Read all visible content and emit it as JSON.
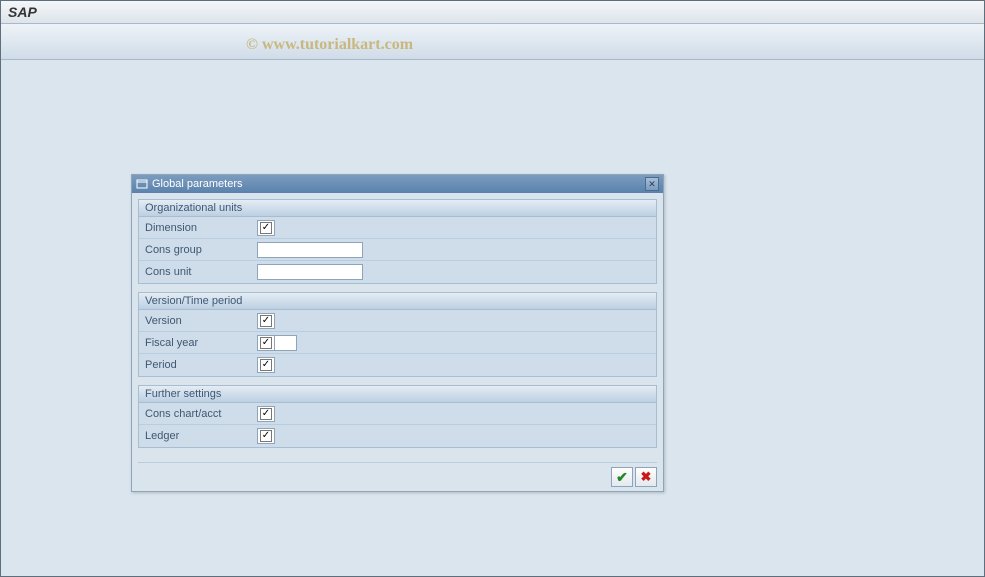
{
  "app": {
    "title": "SAP"
  },
  "watermark": "© www.tutorialkart.com",
  "dialog": {
    "title": "Global parameters",
    "groups": {
      "org": {
        "title": "Organizational units",
        "dimension_label": "Dimension",
        "cons_group_label": "Cons group",
        "cons_unit_label": "Cons unit",
        "dimension_checked": "✓",
        "cons_group_value": "",
        "cons_unit_value": ""
      },
      "version": {
        "title": "Version/Time period",
        "version_label": "Version",
        "fiscal_year_label": "Fiscal year",
        "period_label": "Period",
        "version_checked": "✓",
        "fiscal_year_checked": "✓",
        "period_checked": "✓"
      },
      "further": {
        "title": "Further settings",
        "cons_chart_label": "Cons chart/acct",
        "ledger_label": "Ledger",
        "cons_chart_checked": "✓",
        "ledger_checked": "✓"
      }
    },
    "buttons": {
      "ok": "✔",
      "cancel": "✖"
    }
  }
}
